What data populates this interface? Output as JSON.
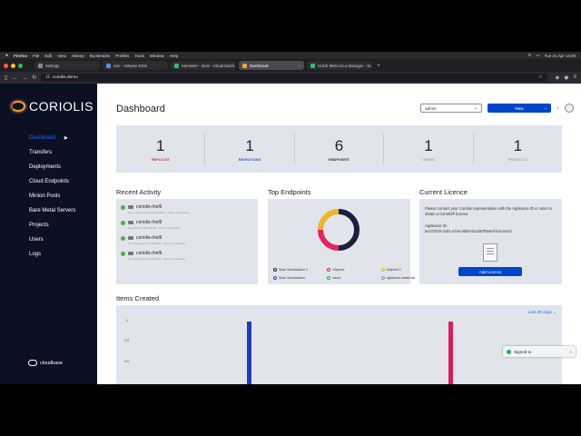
{
  "menubar": {
    "app": "Firefox",
    "menus": [
      "File",
      "Edit",
      "View",
      "History",
      "Bookmarks",
      "Profiles",
      "Tools",
      "Window",
      "Help"
    ],
    "clock": "Tue 21 Apr 14:09"
  },
  "tabs": [
    {
      "label": "Settings",
      "active": false
    },
    {
      "label": "esxi - VMware ESXi",
      "active": false
    },
    {
      "label": "Harvester - local - Virtual Machi",
      "active": false
    },
    {
      "label": "Dashboard",
      "active": true
    },
    {
      "label": "SUSE Multi-Linux Manager - Sc",
      "active": false
    }
  ],
  "url": "coriolis.demo",
  "brand": "CORIOLIS",
  "footer_brand": "cloudbase",
  "nav": [
    {
      "label": "Dashboard",
      "active": true
    },
    {
      "label": "Transfers",
      "active": false
    },
    {
      "label": "Deployments",
      "active": false
    },
    {
      "label": "Cloud Endpoints",
      "active": false
    },
    {
      "label": "Minion Pools",
      "active": false
    },
    {
      "label": "Bare Metal Servers",
      "active": false
    },
    {
      "label": "Projects",
      "active": false
    },
    {
      "label": "Users",
      "active": false
    },
    {
      "label": "Logs",
      "active": false
    }
  ],
  "header": {
    "title": "Dashboard",
    "project_select": "admin",
    "new_button": "New"
  },
  "stats": [
    {
      "value": "1",
      "label": "REPLICAS",
      "color": "#d21f4a"
    },
    {
      "value": "1",
      "label": "MIGRATIONS",
      "color": "#1f55c7"
    },
    {
      "value": "6",
      "label": "ENDPOINTS",
      "color": "#222222"
    },
    {
      "value": "1",
      "label": "USERS",
      "color": "#a0a4ad"
    },
    {
      "value": "1",
      "label": "PROJECTS",
      "color": "#a0a4ad"
    }
  ],
  "recent_activity": {
    "title": "Recent Activity",
    "items": [
      {
        "name": "coriolis-rhel9",
        "sub": "New replica created 8d7e8b91 - status: completed"
      },
      {
        "name": "coriolis-rhel9",
        "sub": "New transfer 8d7e8b91 - status: completed"
      },
      {
        "name": "coriolis-rhel9",
        "sub": "New deployment 8d7e8b91 - status: completed"
      },
      {
        "name": "coriolis-rhel9",
        "sub": "New deployment 8d7e8b91 - status: completed"
      }
    ]
  },
  "top_endpoints": {
    "title": "Top Endpoints",
    "legend": [
      {
        "label": "Suse Virtualization 2",
        "color": "#1a1f3d"
      },
      {
        "label": "vSphere",
        "color": "#e0245e"
      },
      {
        "label": "vSphere 2",
        "color": "#f0b429"
      },
      {
        "label": "Suse Virtualization",
        "color": "#1f55c7"
      },
      {
        "label": "Azure",
        "color": "#27ae60"
      },
      {
        "label": "appliance-metal-hub",
        "color": "#999999"
      }
    ]
  },
  "licence": {
    "title": "Current Licence",
    "text": "Please contact your Coriolis representative with the Appliance ID in order to obtain a Coriolis® licence.",
    "id_label": "Appliance ID:",
    "id_value": "8cc070cb-c5d1-47ee-8d00-521d67f6e6ef-licencev2",
    "button": "Add Licence"
  },
  "items_created": {
    "title": "Items Created",
    "range": "Last 30 days",
    "y_ticks": [
      "1",
      "0.8",
      "0.6"
    ]
  },
  "chart_data": {
    "type": "bar",
    "series": [
      {
        "name": "",
        "color": "#1f3fb5",
        "x_position": 0.27,
        "value": 1
      },
      {
        "name": "",
        "color": "#d61f5c",
        "x_position": 0.75,
        "value": 1
      }
    ],
    "ylim": [
      0,
      1
    ]
  },
  "toast": {
    "text": "Signed in"
  }
}
